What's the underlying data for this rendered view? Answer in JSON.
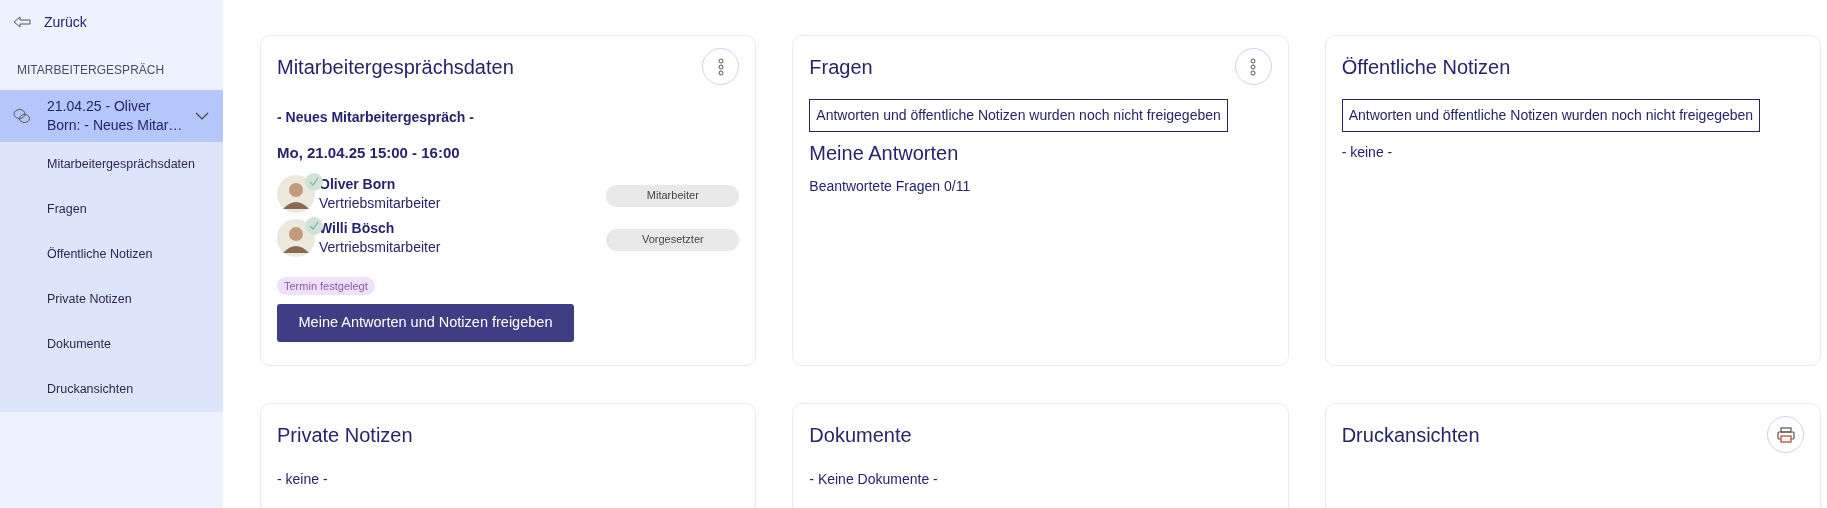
{
  "sidebar": {
    "back_label": "Zurück",
    "section_title": "MITARBEITERGESPRÄCH",
    "conversation": {
      "label": "21.04.25 - Oliver Born: - Neues Mitar…",
      "selected": true,
      "expanded": true
    },
    "items": [
      {
        "label": "Mitarbeitergesprächsdaten",
        "selected": false
      },
      {
        "label": "Fragen",
        "selected": false
      },
      {
        "label": "Öffentliche Notizen",
        "selected": false
      },
      {
        "label": "Private Notizen",
        "selected": false
      },
      {
        "label": "Dokumente",
        "selected": false
      },
      {
        "label": "Druckansichten",
        "selected": false
      }
    ]
  },
  "cards": [
    {
      "kind": "details",
      "title": "Mitarbeitergesprächsdaten",
      "menu_button": true,
      "subject": "- Neues Mitarbeitergespräch -",
      "date": "Mo, 21.04.25 15:00 - 16:00",
      "participants": [
        {
          "name": "Oliver Born",
          "position": "Vertriebsmitarbeiter",
          "role": "Mitarbeiter",
          "confirmed": true
        },
        {
          "name": "Willi Bösch",
          "position": "Vertriebsmitarbeiter",
          "role": "Vorgesetzter",
          "confirmed": true
        }
      ],
      "status_tag": "Termin festgelegt",
      "button": "Meine Antworten und Notizen freigeben"
    },
    {
      "kind": "questions",
      "title": "Fragen",
      "menu_button": true,
      "notice": "Antworten und öffentliche Notizen wurden noch nicht freigegeben",
      "heading": "Meine Antworten",
      "progress": "Beantwortete Fragen 0/11"
    },
    {
      "kind": "notes",
      "title": "Öffentliche Notizen",
      "notice": "Antworten und öffentliche Notizen wurden noch nicht freigegeben",
      "text": "- keine -"
    },
    {
      "kind": "text",
      "title": "Private Notizen",
      "text": "- keine -"
    },
    {
      "kind": "text",
      "title": "Dokumente",
      "text": "- Keine Dokumente -"
    },
    {
      "kind": "text",
      "title": "Druckansichten",
      "print_button": true
    }
  ]
}
